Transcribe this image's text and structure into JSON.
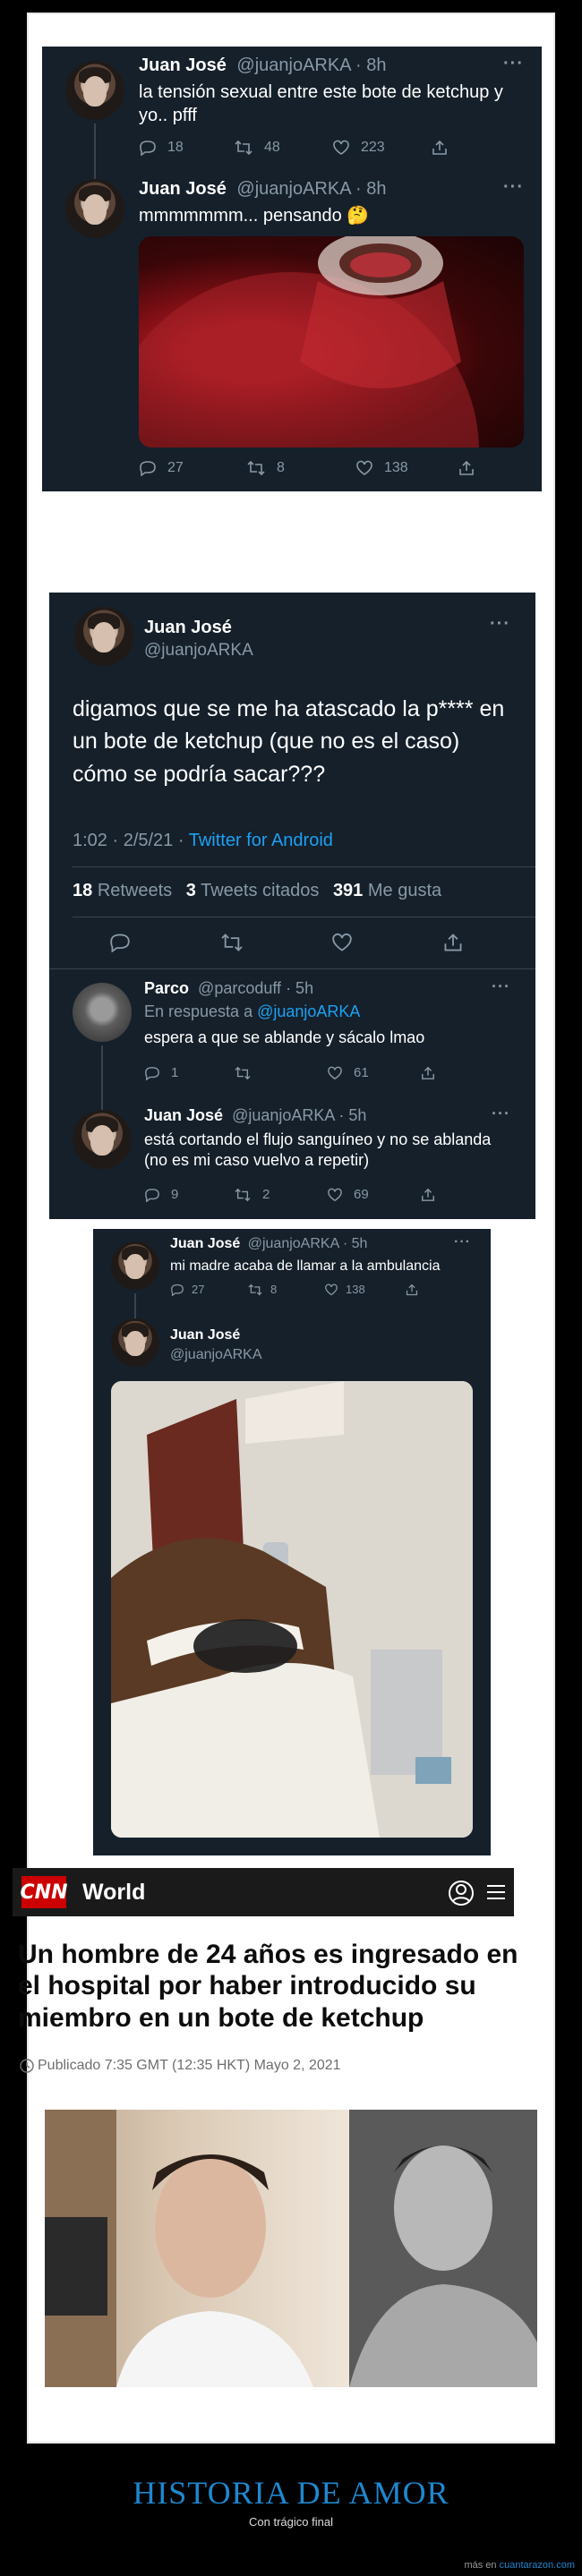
{
  "tweet1": {
    "name": "Juan José",
    "handle": "@juanjoARKA",
    "time": "· 8h",
    "text": "la tensión sexual entre este bote de ketchup y yo.. pfff",
    "replies": "18",
    "retweets": "48",
    "likes": "223"
  },
  "tweet2": {
    "name": "Juan José",
    "handle": "@juanjoARKA",
    "time": "· 8h",
    "text": "mmmmmmm... pensando 🤔",
    "replies": "27",
    "retweets": "8",
    "likes": "138"
  },
  "tweet3": {
    "name": "Juan José",
    "handle": "@juanjoARKA",
    "text": "digamos que se me ha atascado la p**** en un bote de ketchup (que no es el caso) cómo se podría sacar???",
    "meta_time": "1:02 · 2/5/21 · ",
    "meta_source": "Twitter for Android",
    "retweets_num": "18",
    "retweets_label": "Retweets",
    "quotes_num": "3",
    "quotes_label": "Tweets citados",
    "likes_num": "391",
    "likes_label": "Me gusta"
  },
  "reply1": {
    "name": "Parco",
    "handle": "@parcoduff",
    "time": "· 5h",
    "reply_to_prefix": "En respuesta a ",
    "reply_to_handle": "@juanjoARKA",
    "text": "espera a que se ablande y sácalo lmao",
    "replies": "1",
    "likes": "61"
  },
  "reply2": {
    "name": "Juan José",
    "handle": "@juanjoARKA",
    "time": "· 5h",
    "text": "está cortando el flujo sanguíneo y no se ablanda (no es mi caso vuelvo a repetir)",
    "replies": "9",
    "retweets": "2",
    "likes": "69"
  },
  "tweet4": {
    "name": "Juan José",
    "handle": "@juanjoARKA",
    "time": "· 5h",
    "text": "mi madre acaba de llamar a la ambulancia",
    "replies": "27",
    "retweets": "8",
    "likes": "138"
  },
  "tweet5": {
    "name": "Juan José",
    "handle": "@juanjoARKA"
  },
  "cnn": {
    "logo": "CNN",
    "section": "World",
    "headline": "Un hombre de 24 años es ingresado en el hospital por haber introducido su miembro en un bote de ketchup",
    "published": "Publicado 7:35 GMT (12:35 HKT) Mayo 2, 2021"
  },
  "footer": {
    "title": "HISTORIA DE AMOR",
    "subtitle": "Con trágico final",
    "credit_prefix": "más en ",
    "credit_site": "cuantarazon.com"
  },
  "icons": [
    "reply-icon",
    "retweet-icon",
    "like-icon",
    "share-icon",
    "more-icon",
    "account-icon",
    "menu-icon",
    "clock-icon"
  ],
  "colors": {
    "tweet_bg": "#15202b",
    "link": "#1da1f2",
    "muted": "#8899a6",
    "cnn_red": "#cc0000",
    "footer_title": "#1e88d0"
  }
}
